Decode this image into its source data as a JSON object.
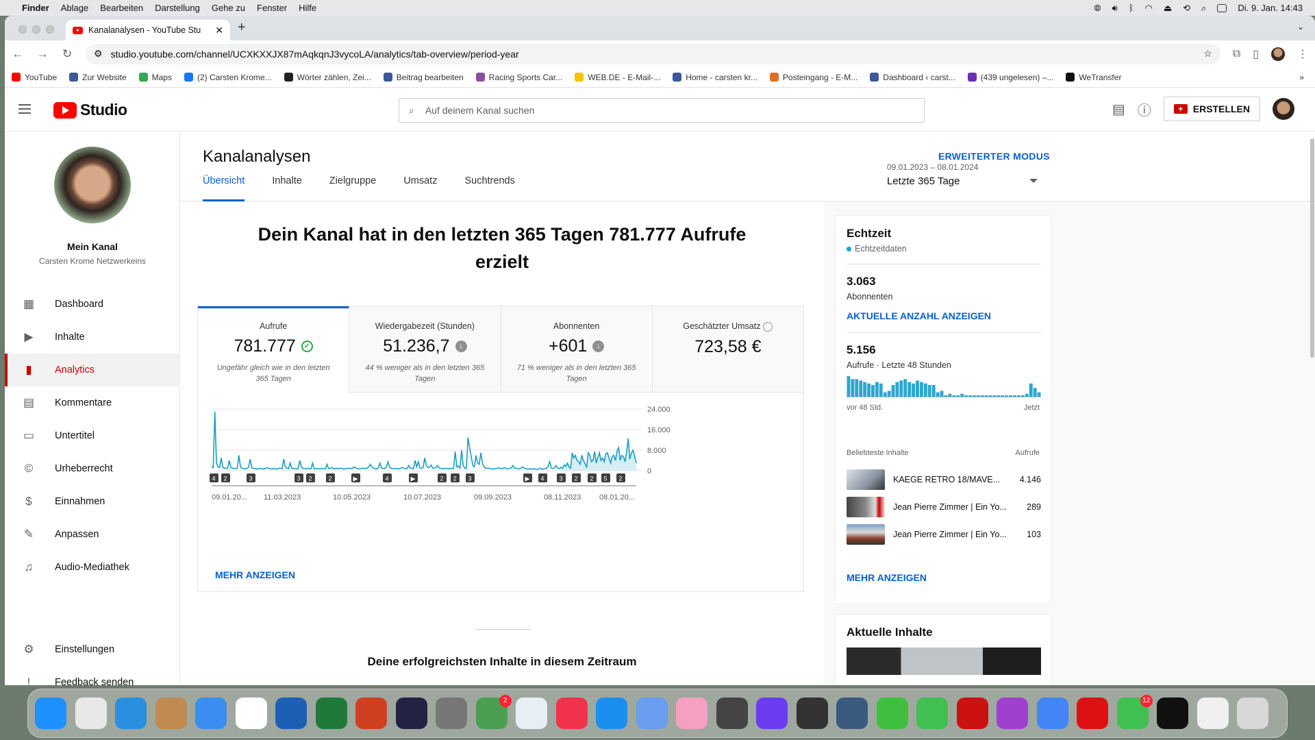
{
  "macos": {
    "menu": [
      "Finder",
      "Ablage",
      "Bearbeiten",
      "Darstellung",
      "Gehe zu",
      "Fenster",
      "Hilfe"
    ],
    "clock": "Di. 9. Jan.  14:43"
  },
  "browser": {
    "tab_title": "Kanalanalysen - YouTube Stu",
    "url": "studio.youtube.com/channel/UCXKXXJX87mAqkqnJ3vycoLA/analytics/tab-overview/period-year",
    "bookmarks": [
      {
        "label": "YouTube",
        "color": "#ff0000"
      },
      {
        "label": "Zur Website",
        "color": "#3c5a99"
      },
      {
        "label": "Maps",
        "color": "#34a853"
      },
      {
        "label": "(2) Carsten Krome...",
        "color": "#1877f2"
      },
      {
        "label": "Wörter zählen, Zei...",
        "color": "#222222"
      },
      {
        "label": "Beitrag bearbeiten",
        "color": "#3c5a99"
      },
      {
        "label": "Racing Sports Car...",
        "color": "#8a4fa0"
      },
      {
        "label": "WEB.DE - E-Mail-...",
        "color": "#f5c400"
      },
      {
        "label": "Home - carsten kr...",
        "color": "#3c5a99"
      },
      {
        "label": "Posteingang - E-M...",
        "color": "#e07020"
      },
      {
        "label": "Dashboard ‹ carst...",
        "color": "#3c5a99"
      },
      {
        "label": "(439 ungelesen) –...",
        "color": "#6b2fb3"
      },
      {
        "label": "WeTransfer",
        "color": "#111111"
      }
    ]
  },
  "studio": {
    "logo": "Studio",
    "search_placeholder": "Auf deinem Kanal suchen",
    "create_label": "ERSTELLEN",
    "channel_label": "Mein Kanal",
    "channel_name": "Carsten Krome Netzwerkeins",
    "nav": [
      "Dashboard",
      "Inhalte",
      "Analytics",
      "Kommentare",
      "Untertitel",
      "Urheberrecht",
      "Einnahmen",
      "Anpassen",
      "Audio-Mediathek"
    ],
    "nav_bottom": [
      "Einstellungen",
      "Feedback senden"
    ],
    "page_title": "Kanalanalysen",
    "advanced_mode": "ERWEITERTER MODUS",
    "tabs": [
      "Übersicht",
      "Inhalte",
      "Zielgruppe",
      "Umsatz",
      "Suchtrends"
    ],
    "date_range": "09.01.2023 – 08.01.2024",
    "date_label": "Letzte 365 Tage",
    "headline": "Dein Kanal hat in den letzten 365 Tagen 781.777 Aufrufe erzielt",
    "metrics": [
      {
        "label": "Aufrufe",
        "value": "781.777",
        "note": "Ungefähr gleich wie in den letzten 365 Tagen"
      },
      {
        "label": "Wiedergabezeit (Stunden)",
        "value": "51.236,7",
        "note": "44 % weniger als in den letzten 365 Tagen"
      },
      {
        "label": "Abonnenten",
        "value": "+601",
        "note": "71 % weniger als in den letzten 365 Tagen"
      },
      {
        "label": "Geschätzter Umsatz",
        "value": "723,58 €",
        "note": ""
      }
    ],
    "more": "MEHR ANZEIGEN",
    "top_content_heading": "Deine erfolgreichsten Inhalte in diesem Zeitraum",
    "realtime": {
      "title": "Echtzeit",
      "subtitle": "Echtzeitdaten",
      "subs_value": "3.063",
      "subs_label": "Abonnenten",
      "subs_link": "AKTUELLE ANZAHL ANZEIGEN",
      "views_value": "5.156",
      "views_label": "Aufrufe · Letzte 48 Stunden",
      "from_label": "vor 48 Std.",
      "to_label": "Jetzt",
      "top_label": "Beliebteste Inhalte",
      "top_col": "Aufrufe",
      "videos": [
        {
          "title": "KAEGE RETRO 18/MAVE...",
          "views": "4.146"
        },
        {
          "title": "Jean Pierre Zimmer | Ein Yo...",
          "views": "289"
        },
        {
          "title": "Jean Pierre Zimmer | Ein Yo...",
          "views": "103"
        }
      ],
      "more": "MEHR ANZEIGEN"
    },
    "latest_title": "Aktuelle Inhalte"
  },
  "chart_data": {
    "type": "line",
    "title": "",
    "xlabel": "",
    "ylabel": "",
    "x_ticks": [
      "09.01.20...",
      "11.03.2023",
      "10.05.2023",
      "10.07.2023",
      "09.09.2023",
      "08.11.2023",
      "08.01.20..."
    ],
    "y_ticks": [
      "24.000",
      "16.000",
      "8.000",
      "0"
    ],
    "ylim": [
      0,
      24000
    ],
    "grid": true,
    "series": [
      {
        "values": [
          1500,
          1200,
          23000,
          3000,
          1500,
          1200,
          5000,
          1200,
          1000,
          900,
          900,
          4000,
          1200,
          1000,
          900,
          800,
          1000,
          6000,
          1500,
          900,
          800,
          700,
          900,
          1200,
          4500,
          1200,
          900,
          800,
          700,
          700,
          900,
          800,
          700,
          700,
          1000,
          1200,
          800,
          700,
          700,
          900,
          700,
          700,
          1000,
          900,
          800,
          4500,
          1500,
          1000,
          800,
          3000,
          900,
          900,
          800,
          700,
          800,
          4000,
          1500,
          900,
          800,
          700,
          1000,
          700,
          800,
          3000,
          700,
          800,
          900,
          700,
          800,
          900,
          800,
          700,
          2500,
          800,
          900,
          1200,
          900,
          700,
          1000,
          700,
          1000,
          900,
          700,
          700,
          800,
          900,
          1000,
          800,
          1000,
          1500,
          1000,
          900,
          700,
          800,
          900,
          1000,
          800,
          1000,
          1500,
          2500,
          1500,
          1000,
          800,
          700,
          1200,
          3000,
          1000,
          900,
          800,
          1300,
          3500,
          1500,
          1000,
          800,
          800,
          900,
          700,
          800,
          1000,
          1200,
          1000,
          700,
          900,
          2000,
          1000,
          900,
          800,
          4000,
          1500,
          3500,
          1000,
          900,
          1300,
          5000,
          2000,
          1200,
          1500,
          2200,
          1000,
          900,
          1300,
          2000,
          1100,
          900,
          800,
          700,
          1000,
          900,
          700,
          1000,
          800,
          900,
          7500,
          1500,
          1800,
          1000,
          8000,
          2000,
          1000,
          900,
          13000,
          9000,
          5500,
          2000,
          1500,
          6000,
          3000,
          2500,
          7000,
          3000,
          1500,
          1000,
          900,
          1000,
          800,
          700,
          700,
          800,
          1000,
          1100,
          900,
          800,
          1000,
          1200,
          800,
          700,
          900,
          1100,
          2000,
          1000,
          1000,
          800,
          700,
          900,
          1500,
          1000,
          800,
          700,
          600,
          800,
          600,
          800,
          700,
          500,
          700,
          1000,
          600,
          700,
          800,
          900,
          1800,
          3500,
          1000,
          900,
          1200,
          2000,
          1000,
          800,
          1300,
          1000,
          2300,
          1700,
          3000,
          1500,
          1000,
          7000,
          5000,
          6000,
          4000,
          3500,
          2500,
          6000,
          4000,
          2800,
          1200,
          7000,
          6000,
          3500,
          4000,
          7500,
          3000,
          5000,
          7000,
          4000,
          5000,
          3500,
          6500,
          7000,
          5000,
          3000,
          5500,
          6000,
          4000,
          7500,
          9000,
          4000,
          6000,
          5500,
          3500,
          7500,
          12500,
          4500,
          7000,
          8000,
          5500,
          3000
        ]
      }
    ],
    "markers": [
      "4",
      "2",
      "3",
      "3",
      "2",
      "2",
      "▶",
      "4",
      "▶",
      "2",
      "2",
      "3",
      "▶",
      "4",
      "3",
      "2",
      "2",
      "5",
      "2"
    ]
  },
  "realtime_bars": [
    14,
    12,
    12,
    11,
    10,
    9,
    8,
    10,
    9,
    3,
    4,
    8,
    10,
    11,
    12,
    10,
    9,
    11,
    10,
    9,
    8,
    8,
    3,
    4,
    1,
    2,
    1,
    1,
    2,
    1,
    1,
    1,
    1,
    1,
    1,
    1,
    1,
    1,
    1,
    1,
    1,
    1,
    1,
    1,
    2,
    9,
    6,
    3
  ]
}
